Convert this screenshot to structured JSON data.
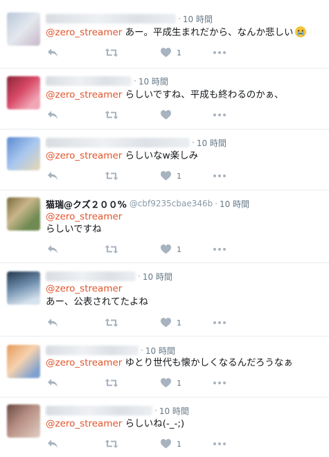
{
  "icons": {
    "reply": "reply-icon",
    "retweet": "retweet-icon",
    "like": "heart-icon",
    "more": "more-icon"
  },
  "colors": {
    "mention": "#e0532a",
    "meta": "#8899a6",
    "icon": "#a7b3bf",
    "border": "#e6ecf0"
  },
  "tweets": [
    {
      "name": "",
      "handle": "",
      "time": "10 時間",
      "mention": "@zero_streamer",
      "text": "あー。平成生まれだから、なんか悲しい",
      "emoji": "crying-face",
      "likes": "1"
    },
    {
      "name": "",
      "handle": "",
      "time": "10 時間",
      "mention": "@zero_streamer",
      "text": "らしいですね、平成も終わるのかぁ、",
      "likes": ""
    },
    {
      "name": "",
      "handle": "",
      "time": "10 時間",
      "mention": "@zero_streamer",
      "text": "らしいなw楽しみ",
      "likes": "1"
    },
    {
      "name": "猫瑞@クズ２００%",
      "handle": "@cbf9235cbae346b",
      "time": "10 時間",
      "mention": "@zero_streamer",
      "text": "らしいですね",
      "likes": "1"
    },
    {
      "name": "",
      "handle": "",
      "time": "10 時間",
      "mention": "@zero_streamer",
      "text": "あー、公表されてたよね",
      "likes": "1"
    },
    {
      "name": "",
      "handle": "",
      "time": "10 時間",
      "mention": "@zero_streamer",
      "text": "ゆとり世代も懐かしくなるんだろうなぁ",
      "likes": "1"
    },
    {
      "name": "",
      "handle": "",
      "time": "10 時間",
      "mention": "@zero_streamer",
      "text": "らしいね(-_-;)",
      "likes": "1"
    }
  ]
}
